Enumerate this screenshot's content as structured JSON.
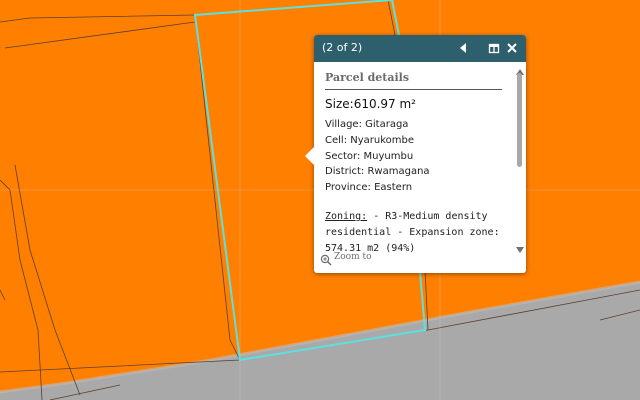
{
  "map": {
    "colors": {
      "zone_fill": "#ff7f00",
      "road": "#a9a9a9",
      "parcel_line": "#5a4030",
      "selected_outline": "#5ce1e0"
    }
  },
  "popup": {
    "count_label": "(2 of 2)",
    "header_color": "#2d5f6c",
    "icons": [
      "previous-icon",
      "dock-icon",
      "close-icon"
    ],
    "title": "Parcel details",
    "size_label": "Size:",
    "size_value": "610.97 m²",
    "fields": [
      {
        "label": "Village:",
        "value": "Gitaraga"
      },
      {
        "label": "Cell:",
        "value": "Nyarukombe"
      },
      {
        "label": "Sector:",
        "value": "Muyumbu"
      },
      {
        "label": "District:",
        "value": "Rwamagana"
      },
      {
        "label": "Province:",
        "value": "Eastern"
      }
    ],
    "zoning_label": "Zoning:",
    "zoning_text": "- R3-Medium density residential - Expansion zone: 574.31 m2 (94%)",
    "zoom_label": "Zoom to"
  }
}
